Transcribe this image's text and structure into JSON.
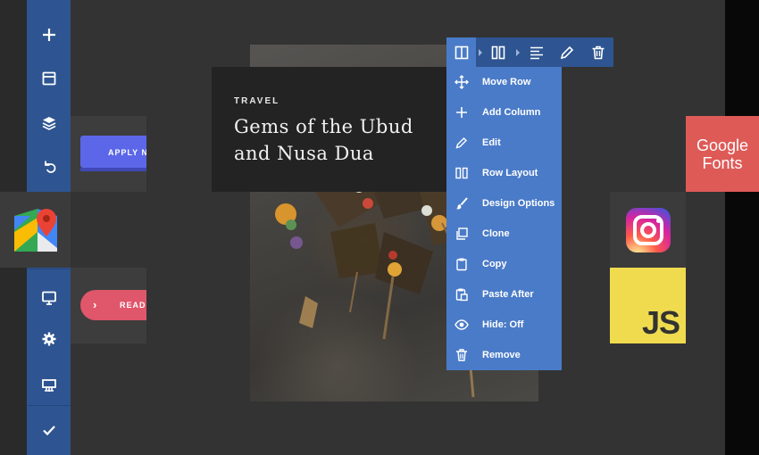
{
  "colors": {
    "sidebar": "#2e5591",
    "menu": "#4a7bc8",
    "apply_button": "#5b67e8",
    "read_button": "#e0566b",
    "google_fonts": "#de5a57",
    "javascript": "#f0db4f"
  },
  "sidebar": {
    "items": [
      {
        "icon": "plus-icon"
      },
      {
        "icon": "templates-icon"
      },
      {
        "icon": "layers-icon"
      },
      {
        "icon": "undo-icon"
      },
      {
        "icon": "monitor-icon"
      },
      {
        "icon": "gear-icon"
      },
      {
        "icon": "frontend-editor-icon"
      },
      {
        "icon": "check-icon"
      }
    ]
  },
  "elements": {
    "apply_button": "APPLY N",
    "read_button": "READ",
    "google_fonts_line1": "Google",
    "google_fonts_line2": "Fonts",
    "js_label": "JS"
  },
  "hero": {
    "kicker": "TRAVEL",
    "title": "Gems of the Ubud and Nusa Dua"
  },
  "row_toolbar": {
    "buttons": [
      "row-icon",
      "columns-icon",
      "align-icon",
      "pencil-icon",
      "trash-icon"
    ]
  },
  "context_menu": {
    "items": [
      {
        "icon": "move-icon",
        "label": "Move Row"
      },
      {
        "icon": "plus-icon",
        "label": "Add Column"
      },
      {
        "icon": "pencil-icon",
        "label": "Edit"
      },
      {
        "icon": "row-layout-icon",
        "label": "Row Layout"
      },
      {
        "icon": "brush-icon",
        "label": "Design Options"
      },
      {
        "icon": "clone-icon",
        "label": "Clone"
      },
      {
        "icon": "clipboard-icon",
        "label": "Copy"
      },
      {
        "icon": "paste-icon",
        "label": "Paste After"
      },
      {
        "icon": "eye-icon",
        "label": "Hide: Off"
      },
      {
        "icon": "trash-icon",
        "label": "Remove"
      }
    ]
  }
}
